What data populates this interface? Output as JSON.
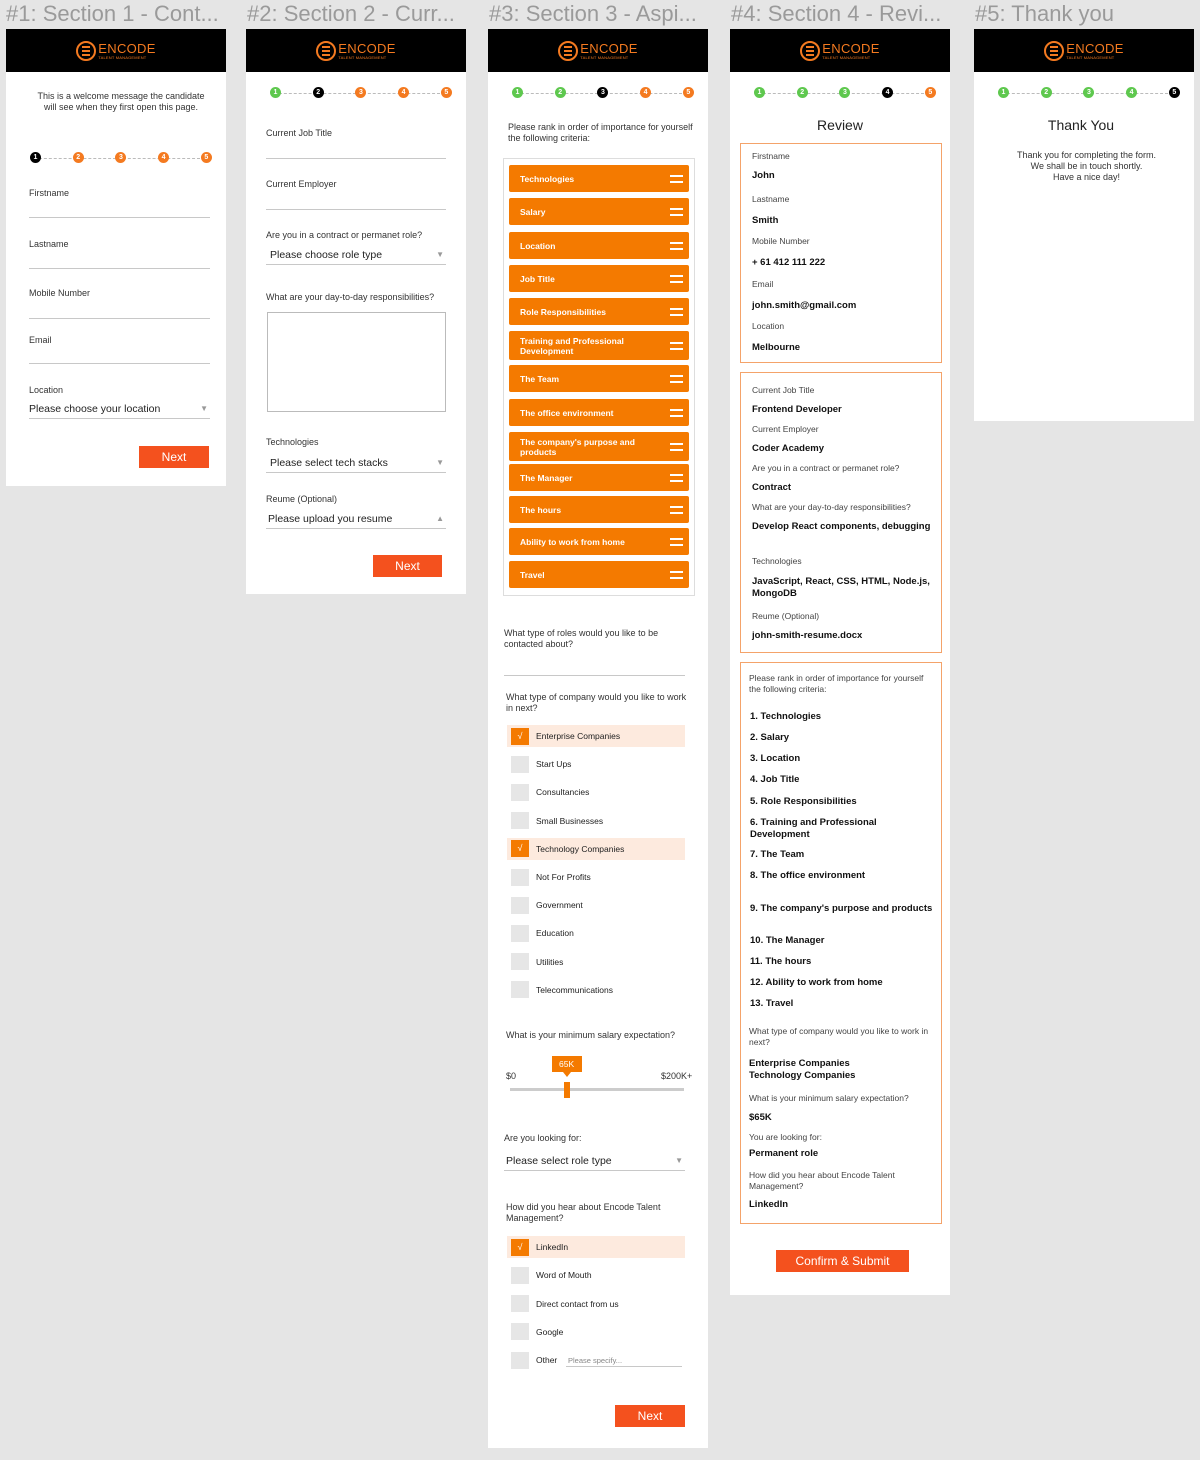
{
  "frames": {
    "f1": "#1: Section 1 - Cont...",
    "f2": "#2: Section 2 - Curr...",
    "f3": "#3: Section 3 - Aspi...",
    "f4": "#4: Section 4 - Revi...",
    "f5": "#5: Thank you"
  },
  "brand": {
    "name": "ENCODE",
    "tagline": "TALENT MANAGEMENT",
    "accent": "#f47a20",
    "button": "#f4511e"
  },
  "steps": [
    "1",
    "2",
    "3",
    "4",
    "5"
  ],
  "s1": {
    "welcome": "This is a welcome message the candidate will see when they first open this page.",
    "firstname": "Firstname",
    "lastname": "Lastname",
    "mobile": "Mobile Number",
    "email": "Email",
    "location": "Location",
    "location_placeholder": "Please choose your location",
    "next": "Next"
  },
  "s2": {
    "job_title": "Current Job Title",
    "employer": "Current Employer",
    "role_q": "Are you in a contract or permanet role?",
    "role_placeholder": "Please choose role type",
    "resp_q": "What are your day-to-day responsibilities?",
    "tech": "Technologies",
    "tech_placeholder": "Please select tech stacks",
    "resume": "Reume (Optional)",
    "resume_placeholder": "Please upload you resume",
    "next": "Next"
  },
  "s3": {
    "rank_q": "Please rank in order of importance for yourself the following criteria:",
    "rank_items": [
      "Technologies",
      "Salary",
      "Location",
      "Job Title",
      "Role Responsibilities",
      "Training and Professional Development",
      "The Team",
      "The office environment",
      "The company's purpose and products",
      "The Manager",
      "The hours",
      "Ability to work from home",
      "Travel"
    ],
    "roles_q": "What type of roles would you like to be contacted about?",
    "company_q": "What type of company would you like to work in next?",
    "company_options": [
      {
        "label": "Enterprise Companies",
        "checked": true
      },
      {
        "label": "Start Ups",
        "checked": false
      },
      {
        "label": "Consultancies",
        "checked": false
      },
      {
        "label": "Small Businesses",
        "checked": false
      },
      {
        "label": "Technology Companies",
        "checked": true
      },
      {
        "label": "Not For Profits",
        "checked": false
      },
      {
        "label": "Government",
        "checked": false
      },
      {
        "label": "Education",
        "checked": false
      },
      {
        "label": "Utilities",
        "checked": false
      },
      {
        "label": "Telecommunications",
        "checked": false
      }
    ],
    "check_mark": "√",
    "salary_q": "What is your minimum salary expectation?",
    "salary_min": "$0",
    "salary_max": "$200K+",
    "salary_value": "65K",
    "salary_fraction": 0.325,
    "looking_q": "Are you looking for:",
    "looking_placeholder": "Please select role type",
    "hear_q": "How did you hear about Encode Talent Management?",
    "hear_options": [
      {
        "label": "LinkedIn",
        "checked": true
      },
      {
        "label": "Word of Mouth",
        "checked": false
      },
      {
        "label": "Direct contact from us",
        "checked": false
      },
      {
        "label": "Google",
        "checked": false
      },
      {
        "label": "Other",
        "checked": false
      }
    ],
    "other_placeholder": "Please specify...",
    "next": "Next"
  },
  "s4": {
    "title": "Review",
    "personal": [
      {
        "label": "Firstname",
        "value": "John"
      },
      {
        "label": "Lastname",
        "value": "Smith"
      },
      {
        "label": "Mobile Number",
        "value": "+ 61 412 111 222"
      },
      {
        "label": "Email",
        "value": "john.smith@gmail.com"
      },
      {
        "label": "Location",
        "value": "Melbourne"
      }
    ],
    "current": [
      {
        "label": "Current Job Title",
        "value": "Frontend Developer"
      },
      {
        "label": "Current Employer",
        "value": "Coder Academy"
      },
      {
        "label": "Are you in a contract or permanet role?",
        "value": "Contract"
      },
      {
        "label": "What are your day-to-day responsibilities?",
        "value": "Develop React components, debugging"
      },
      {
        "label": "Technologies",
        "value": "JavaScript, React, CSS, HTML, Node.js, MongoDB"
      },
      {
        "label": "Reume (Optional)",
        "value": "john-smith-resume.docx"
      }
    ],
    "rank_q": "Please rank in order of importance for yourself the following criteria:",
    "ranks": [
      "1. Technologies",
      "2. Salary",
      "3. Location",
      "4. Job Title",
      "5. Role Responsibilities",
      "6. Training and Professional Development",
      "7. The Team",
      "8. The office environment",
      "9. The company's purpose and products",
      "10. The Manager",
      "11. The hours",
      "12. Ability to work from home",
      "13. Travel"
    ],
    "company_q": "What type of company would you like to work in next?",
    "company_val1": "Enterprise Companies",
    "company_val2": "Technology Companies",
    "salary_q": "What is your minimum salary expectation?",
    "salary_val": "$65K",
    "looking_q": "You are looking for:",
    "looking_val": "Permanent role",
    "hear_q": "How did you hear about Encode Talent Management?",
    "hear_val": "LinkedIn",
    "submit": "Confirm & Submit"
  },
  "s5": {
    "title": "Thank You",
    "line1": "Thank you for completing the form.",
    "line2": "We shall be in touch shortly.",
    "line3": "Have a nice day!"
  }
}
